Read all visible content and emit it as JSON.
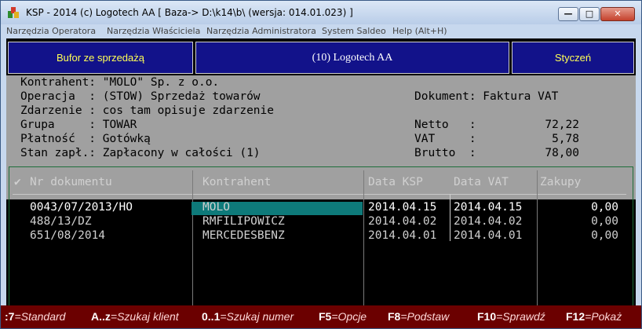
{
  "window": {
    "title": "KSP - 2014 (c) Logotech AA  [  Baza-> D:\\k14\\b\\  (wersja: 014.01.023)  ]",
    "minimize": "—",
    "maximize": "□",
    "close": "✕"
  },
  "menu": [
    "Narzędzia Operatora",
    "Narzędzia Właściciela",
    "Narzędzia Administratora",
    "System Saldeo",
    "Help (Alt+H)"
  ],
  "top_buttons": {
    "bufor": "Bufor ze sprzedażą",
    "company": "(10)  Logotech AA",
    "month": "Styczeń"
  },
  "info": {
    "kontrahent": "Kontrahent: \"MOLO\" Sp. z o.o.",
    "operacja": "Operacja  : (STOW) Sprzedaż towarów",
    "zdarzenie": "Zdarzenie : cos tam opisuje zdarzenie",
    "grupa": "Grupa     : TOWAR",
    "platnosc": "Płatność  : Gotówką",
    "stan": "Stan zapł.: Zapłacony w całości (1)",
    "dokument": "Dokument: Faktura VAT",
    "netto_label": "Netto   :",
    "netto_value": "72,22",
    "vat_label": "VAT     :",
    "vat_value": "5,78",
    "brutto_label": "Brutto  :",
    "brutto_value": "78,00"
  },
  "table": {
    "headers": {
      "check": "✔",
      "nr": "Nr dokumentu",
      "kontrahent": "Kontrahent",
      "data_ksp": "Data KSP",
      "data_vat": "Data VAT",
      "zakupy": "Zakupy"
    },
    "rows": [
      {
        "nr": "0043/07/2013/HO",
        "kontrahent": "MOLO",
        "data_ksp": "2014.04.15",
        "data_vat": "2014.04.15",
        "zakupy": "0,00"
      },
      {
        "nr": "488/13/DZ",
        "kontrahent": "RMFILIPOWICZ",
        "data_ksp": "2014.04.02",
        "data_vat": "2014.04.02",
        "zakupy": "0,00"
      },
      {
        "nr": "651/08/2014",
        "kontrahent": "MERCEDESBENZ",
        "data_ksp": "2014.04.01",
        "data_vat": "2014.04.01",
        "zakupy": "0,00"
      }
    ]
  },
  "status_keys": [
    {
      "key": ":7",
      "label": "=Standard"
    },
    {
      "key": "A..z",
      "label": "=Szukaj klient"
    },
    {
      "key": "0..1",
      "label": "=Szukaj numer"
    },
    {
      "key": "F5",
      "label": "=Opcje"
    },
    {
      "key": "F8",
      "label": "=Podstaw"
    },
    {
      "key": "F10",
      "label": "=Sprawdź"
    },
    {
      "key": "F12",
      "label": "=Pokaż"
    }
  ]
}
